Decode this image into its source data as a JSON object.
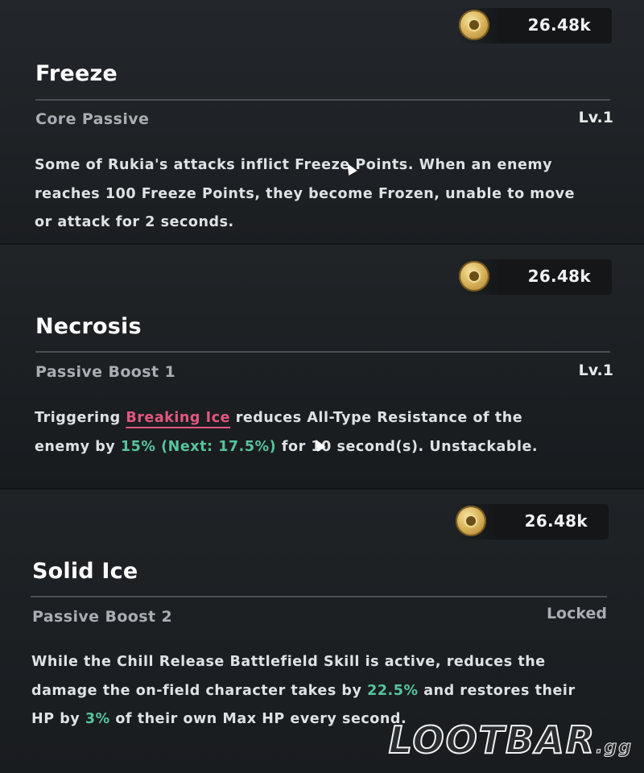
{
  "skills": [
    {
      "name": "Freeze",
      "type": "Core Passive",
      "level": "Lv.1",
      "cost": "26.48k",
      "description_lines": [
        "Some of Rukia's attacks inflict Freeze Points. When an enemy",
        "reaches 100 Freeze Points, they become Frozen, unable to move",
        "or attack for 2 seconds."
      ]
    },
    {
      "name": "Necrosis",
      "type": "Passive Boost 1",
      "level": "Lv.1",
      "cost": "26.48k",
      "description": {
        "l1_a": "Triggering ",
        "l1_link": "Breaking Ice",
        "l1_b": " reduces All-Type Resistance of the",
        "l2_a": "enemy by ",
        "l2_hl": "15% (Next: 17.5%)",
        "l2_b": " for 10 second(s). Unstackable."
      }
    },
    {
      "name": "Solid Ice",
      "type": "Passive Boost 2",
      "level": "Locked",
      "cost": "26.48k",
      "description": {
        "l1": "While the Chill Release Battlefield Skill is active, reduces the",
        "l2_a": "damage the on-field character takes by ",
        "l2_hl": "22.5%",
        "l2_b": " and restores their",
        "l3_a": "HP by ",
        "l3_hl": "3%",
        "l3_b": " of their own Max HP every second."
      }
    }
  ],
  "watermark": {
    "main": "LOOTBAR",
    "suffix": ".gg"
  },
  "icons": {
    "cost": "gold-coin-icon"
  },
  "colors": {
    "highlight_green": "#57c49c",
    "highlight_pink": "#e2577f"
  }
}
